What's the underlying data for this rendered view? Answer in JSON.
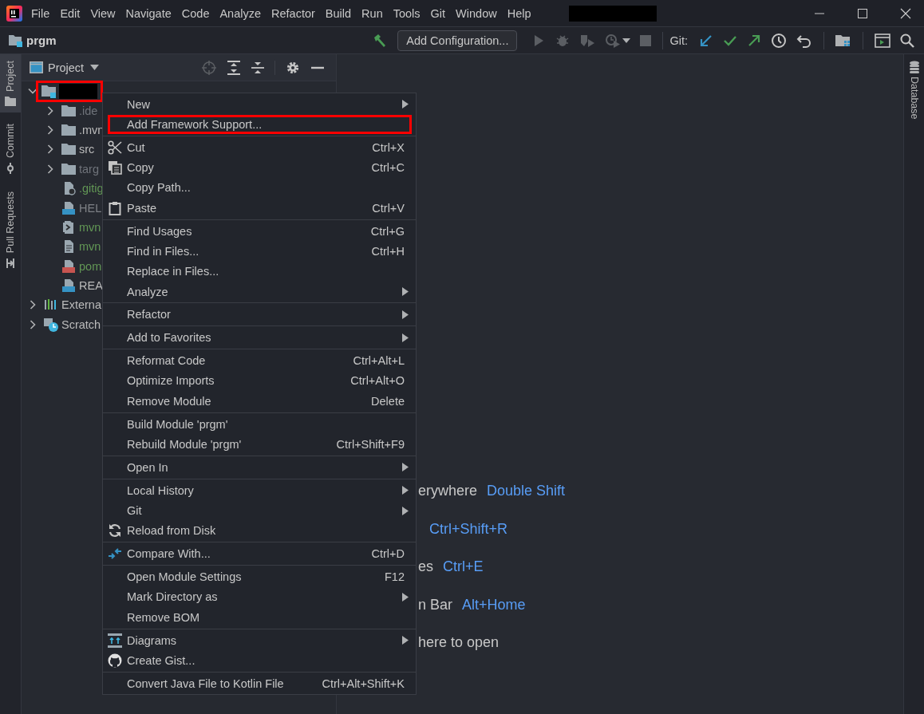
{
  "title_bar": {
    "menus": [
      {
        "label": "File"
      },
      {
        "label": "Edit"
      },
      {
        "label": "View"
      },
      {
        "label": "Navigate"
      },
      {
        "label": "Code"
      },
      {
        "label": "Analyze"
      },
      {
        "label": "Refactor"
      },
      {
        "label": "Build"
      },
      {
        "label": "Run"
      },
      {
        "label": "Tools"
      },
      {
        "label": "Git"
      },
      {
        "label": "Window"
      },
      {
        "label": "Help"
      }
    ]
  },
  "toolbar": {
    "project_name": "prgm",
    "run_configuration": "Add Configuration...",
    "git_label": "Git:"
  },
  "left_tabs": [
    {
      "label": "Project",
      "selected": true
    },
    {
      "label": "Commit",
      "selected": false
    },
    {
      "label": "Pull Requests",
      "selected": false
    }
  ],
  "project_panel": {
    "title": "Project",
    "tree": [
      {
        "kind": "module",
        "expanded": true,
        "annotated": true,
        "children": [
          {
            "kind": "folder",
            "label": ".ide",
            "color": "#6f737a",
            "expanded": false
          },
          {
            "kind": "folder",
            "label": ".mvn",
            "color": "#bbbbbb",
            "expanded": false
          },
          {
            "kind": "folder",
            "label": "src",
            "color": "#bbbbbb",
            "expanded": false
          },
          {
            "kind": "folder",
            "label": "targ",
            "color": "#6f737a",
            "expanded": false
          },
          {
            "kind": "ignore",
            "label": ".gitig",
            "color": "#629755"
          },
          {
            "kind": "markdown",
            "label": "HEL",
            "color": "#7d8085"
          },
          {
            "kind": "script",
            "label": "mvn",
            "color": "#629755"
          },
          {
            "kind": "text",
            "label": "mvn",
            "color": "#629755"
          },
          {
            "kind": "xml",
            "label": "pom",
            "color": "#629755"
          },
          {
            "kind": "markdown",
            "label": "REA",
            "color": "#bbbbbb"
          }
        ]
      },
      {
        "kind": "libraries",
        "label": "Externa",
        "color": "#bbbbbb",
        "expanded": false,
        "annotated": false
      },
      {
        "kind": "scratches",
        "label": "Scratch",
        "color": "#bbbbbb",
        "expanded": false,
        "annotated": false
      }
    ]
  },
  "context_menu": {
    "sections": [
      [
        {
          "label": "New",
          "submenu": true,
          "annotated": false
        },
        {
          "label": "Add Framework Support...",
          "submenu": false,
          "annotated": true
        }
      ],
      [
        {
          "label": "Cut",
          "shortcut": "Ctrl+X",
          "submenu": false,
          "annotated": false
        },
        {
          "label": "Copy",
          "shortcut": "Ctrl+C",
          "submenu": false,
          "annotated": false
        },
        {
          "label": "Copy Path...",
          "submenu": false,
          "annotated": false
        },
        {
          "label": "Paste",
          "shortcut": "Ctrl+V",
          "submenu": false,
          "annotated": false
        }
      ],
      [
        {
          "label": "Find Usages",
          "shortcut": "Ctrl+G",
          "submenu": false,
          "annotated": false
        },
        {
          "label": "Find in Files...",
          "shortcut": "Ctrl+H",
          "submenu": false,
          "annotated": false
        },
        {
          "label": "Replace in Files...",
          "submenu": false,
          "annotated": false
        },
        {
          "label": "Analyze",
          "submenu": true,
          "annotated": false
        }
      ],
      [
        {
          "label": "Refactor",
          "submenu": true,
          "annotated": false
        }
      ],
      [
        {
          "label": "Add to Favorites",
          "submenu": true,
          "annotated": false
        }
      ],
      [
        {
          "label": "Reformat Code",
          "shortcut": "Ctrl+Alt+L",
          "submenu": false,
          "annotated": false
        },
        {
          "label": "Optimize Imports",
          "shortcut": "Ctrl+Alt+O",
          "submenu": false,
          "annotated": false
        },
        {
          "label": "Remove Module",
          "shortcut": "Delete",
          "submenu": false,
          "annotated": false
        }
      ],
      [
        {
          "label": "Build Module 'prgm'",
          "submenu": false,
          "annotated": false
        },
        {
          "label": "Rebuild Module 'prgm'",
          "shortcut": "Ctrl+Shift+F9",
          "submenu": false,
          "annotated": false
        }
      ],
      [
        {
          "label": "Open In",
          "submenu": true,
          "annotated": false
        }
      ],
      [
        {
          "label": "Local History",
          "submenu": true,
          "annotated": false
        },
        {
          "label": "Git",
          "submenu": true,
          "annotated": false
        },
        {
          "label": "Reload from Disk",
          "submenu": false,
          "annotated": false
        }
      ],
      [
        {
          "label": "Compare With...",
          "shortcut": "Ctrl+D",
          "submenu": false,
          "annotated": false
        }
      ],
      [
        {
          "label": "Open Module Settings",
          "shortcut": "F12",
          "submenu": false,
          "annotated": false
        },
        {
          "label": "Mark Directory as",
          "submenu": true,
          "annotated": false
        },
        {
          "label": "Remove BOM",
          "submenu": false,
          "annotated": false
        }
      ],
      [
        {
          "label": "Diagrams",
          "submenu": true,
          "annotated": false
        },
        {
          "label": "Create Gist...",
          "submenu": false,
          "annotated": false
        }
      ],
      [
        {
          "label": "Convert Java File to Kotlin File",
          "shortcut": "Ctrl+Alt+Shift+K",
          "submenu": false,
          "annotated": false
        }
      ]
    ]
  },
  "editor_hints": [
    {
      "text": "erywhere",
      "shortcut": "Double Shift"
    },
    {
      "shortcut": "Ctrl+Shift+R"
    },
    {
      "text": "es",
      "shortcut": "Ctrl+E"
    },
    {
      "text": "n Bar",
      "shortcut": "Alt+Home"
    },
    {
      "text": "here to open"
    }
  ],
  "right_tabs": [
    {
      "label": "Database"
    }
  ]
}
